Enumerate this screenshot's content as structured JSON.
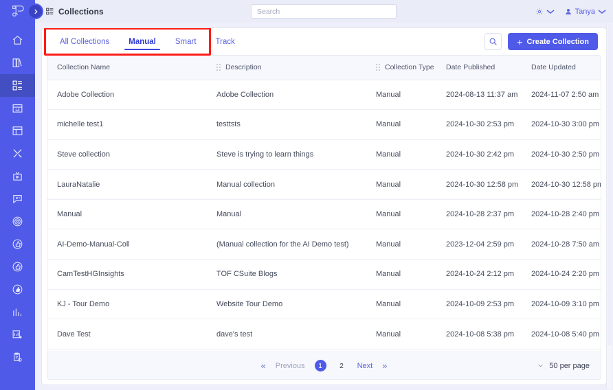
{
  "app": {
    "logo": "logo-mark",
    "expand_icon": "chevron-right-icon"
  },
  "sidebar": {
    "items": [
      {
        "icon": "home-icon",
        "name": "home",
        "active": false
      },
      {
        "icon": "book-icon",
        "name": "library",
        "active": false
      },
      {
        "icon": "collections-icon",
        "name": "collections",
        "active": true
      },
      {
        "icon": "calendar-icon",
        "name": "calendar",
        "active": false
      },
      {
        "icon": "layout-icon",
        "name": "pages",
        "active": false
      },
      {
        "icon": "tools-icon",
        "name": "tools",
        "active": false
      },
      {
        "icon": "video-icon",
        "name": "video",
        "active": false
      },
      {
        "icon": "comment-icon",
        "name": "comments",
        "active": false
      },
      {
        "icon": "target-icon",
        "name": "targets",
        "active": false
      },
      {
        "icon": "thumb-up-icon",
        "name": "engagement-1",
        "active": false
      },
      {
        "icon": "thumb-up-alt-icon",
        "name": "engagement-2",
        "active": false
      },
      {
        "icon": "thumb-up-half-icon",
        "name": "engagement-3",
        "active": false
      },
      {
        "icon": "bar-chart-icon",
        "name": "analytics",
        "active": false
      },
      {
        "icon": "report-add-icon",
        "name": "new-report",
        "active": false
      },
      {
        "icon": "clipboard-gear-icon",
        "name": "task-settings",
        "active": false
      }
    ]
  },
  "topbar": {
    "page_icon": "collections-grid-icon",
    "page_title": "Collections",
    "search_placeholder": "Search",
    "settings_icon": "gear-icon",
    "settings_caret": "chevron-down-icon",
    "user_icon": "user-icon",
    "user_name": "Tanya",
    "user_caret": "chevron-down-icon"
  },
  "tabs": {
    "items": [
      {
        "label": "All Collections",
        "active": false
      },
      {
        "label": "Manual",
        "active": true
      },
      {
        "label": "Smart",
        "active": false
      },
      {
        "label": "Track",
        "active": false
      }
    ],
    "highlight_color": "#fc1d16"
  },
  "actions": {
    "search_icon": "search-icon",
    "create_plus": "+",
    "create_label": "Create Collection",
    "create_color": "#4f5ae8"
  },
  "table": {
    "columns": [
      {
        "label": "Collection Name",
        "grip": false
      },
      {
        "label": "Description",
        "grip": true
      },
      {
        "label": "Collection Type",
        "grip": true
      },
      {
        "label": "Date Published",
        "grip": false
      },
      {
        "label": "Date Updated",
        "grip": false
      }
    ],
    "rows": [
      {
        "name": "Adobe Collection",
        "description": "Adobe Collection",
        "type": "Manual",
        "published": "2024-08-13 11:37 am",
        "updated": "2024-11-07 2:50 am"
      },
      {
        "name": "michelle test1",
        "description": "testtsts",
        "type": "Manual",
        "published": "2024-10-30 2:53 pm",
        "updated": "2024-10-30 3:00 pm"
      },
      {
        "name": "Steve collection",
        "description": "Steve is trying to learn things",
        "type": "Manual",
        "published": "2024-10-30 2:42 pm",
        "updated": "2024-10-30 2:50 pm"
      },
      {
        "name": "LauraNatalie",
        "description": "Manual collection",
        "type": "Manual",
        "published": "2024-10-30 12:58 pm",
        "updated": "2024-10-30 12:58 pm"
      },
      {
        "name": "Manual",
        "description": "Manual",
        "type": "Manual",
        "published": "2024-10-28 2:37 pm",
        "updated": "2024-10-28 2:40 pm"
      },
      {
        "name": "AI-Demo-Manual-Coll",
        "description": "(Manual collection for the AI Demo test)",
        "type": "Manual",
        "published": "2023-12-04 2:59 pm",
        "updated": "2024-10-28 7:50 am"
      },
      {
        "name": "CamTestHGInsights",
        "description": "TOF CSuite Blogs",
        "type": "Manual",
        "published": "2024-10-24 2:12 pm",
        "updated": "2024-10-24 2:20 pm"
      },
      {
        "name": "KJ - Tour Demo",
        "description": "Website Tour Demo",
        "type": "Manual",
        "published": "2024-10-09 2:53 pm",
        "updated": "2024-10-09 3:10 pm"
      },
      {
        "name": "Dave Test",
        "description": "dave's test",
        "type": "Manual",
        "published": "2024-10-08 5:38 pm",
        "updated": "2024-10-08 5:40 pm"
      }
    ]
  },
  "pagination": {
    "first_label": "«",
    "previous_label": "Previous",
    "pages": [
      {
        "label": "1",
        "current": true
      },
      {
        "label": "2",
        "current": false
      }
    ],
    "next_label": "Next",
    "last_label": "»",
    "per_page_label": "50 per page",
    "per_page_caret": "chevron-down-icon"
  }
}
